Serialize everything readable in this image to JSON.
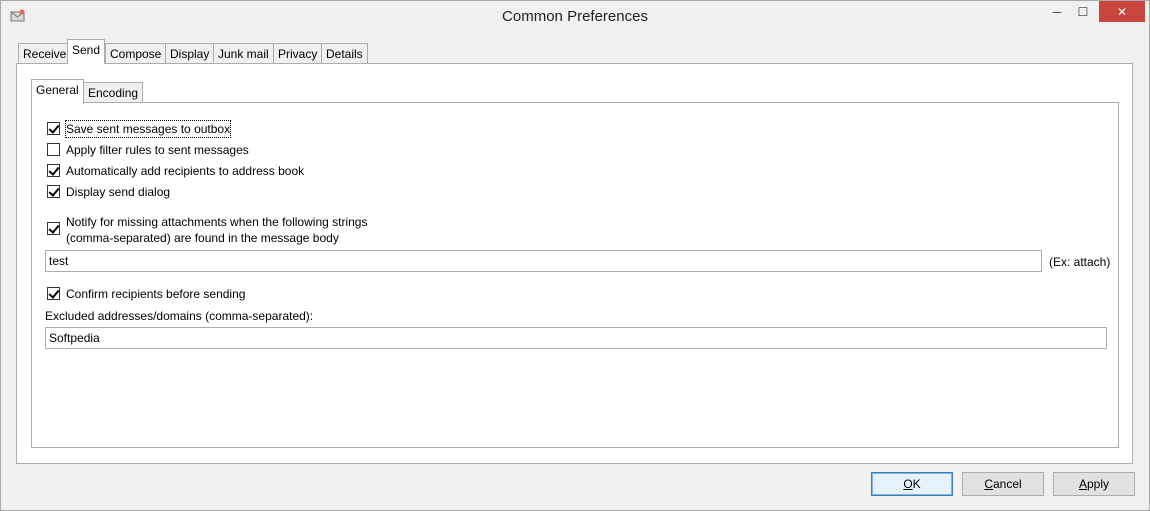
{
  "window": {
    "title": "Common Preferences",
    "minimize_glyph": "─",
    "maximize_glyph": "☐",
    "close_glyph": "✕"
  },
  "tabs": [
    {
      "label": "Receive"
    },
    {
      "label": "Send"
    },
    {
      "label": "Compose"
    },
    {
      "label": "Display"
    },
    {
      "label": "Junk mail"
    },
    {
      "label": "Privacy"
    },
    {
      "label": "Details"
    }
  ],
  "selected_tab": "Send",
  "subtabs": [
    {
      "label": "General"
    },
    {
      "label": "Encoding"
    }
  ],
  "selected_subtab": "General",
  "options": {
    "save_sent": {
      "label": "Save sent messages to outbox",
      "checked": true
    },
    "apply_filter": {
      "label": "Apply filter rules to sent messages",
      "checked": false
    },
    "auto_add": {
      "label": "Automatically add recipients to address book",
      "checked": true
    },
    "display_dialog": {
      "label": "Display send dialog",
      "checked": true
    },
    "notify_missing": {
      "label_line1": "Notify for missing attachments when the following strings",
      "label_line2": "(comma-separated) are found in the message body",
      "checked": true
    },
    "confirm_recipients": {
      "label": "Confirm recipients before sending",
      "checked": true
    }
  },
  "attachment_strings": {
    "value": "test",
    "hint": "(Ex: attach)"
  },
  "excluded": {
    "label": "Excluded addresses/domains (comma-separated):",
    "value": "Softpedia"
  },
  "buttons": {
    "ok": {
      "label": "OK",
      "accel": "O",
      "rest": "K"
    },
    "cancel": {
      "label": "Cancel",
      "accel": "C",
      "rest": "ancel"
    },
    "apply": {
      "label": "Apply",
      "accel": "A",
      "rest": "pply"
    }
  },
  "colors": {
    "close_button": "#c7463d",
    "default_button_border": "#3c7fb1"
  }
}
